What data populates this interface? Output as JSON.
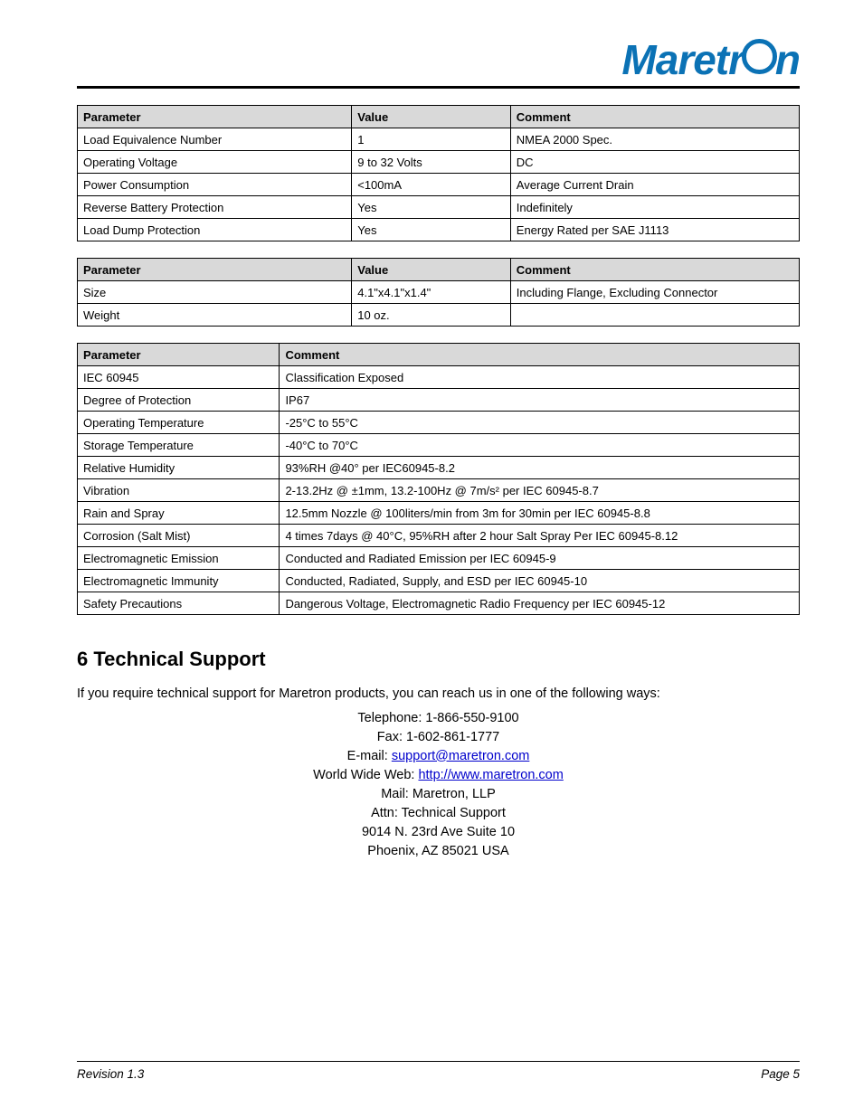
{
  "logo_text_parts": {
    "pre_o": "Maretr",
    "post_o": "n"
  },
  "table1": {
    "headers": [
      "Parameter",
      "Value",
      "Comment"
    ],
    "rows": [
      [
        "Load Equivalence Number",
        "1",
        "NMEA 2000 Spec."
      ],
      [
        "Operating Voltage",
        "9 to 32 Volts",
        "DC"
      ],
      [
        "Power Consumption",
        "<100mA",
        "Average Current Drain"
      ],
      [
        "Reverse Battery Protection",
        "Yes",
        "Indefinitely"
      ],
      [
        "Load Dump Protection",
        "Yes",
        "Energy Rated per SAE J1113"
      ]
    ]
  },
  "table2": {
    "headers": [
      "Parameter",
      "Value",
      "Comment"
    ],
    "rows": [
      [
        "Size",
        "4.1\"x4.1\"x1.4\"",
        "Including Flange, Excluding Connector"
      ],
      [
        "Weight",
        "10 oz.",
        ""
      ]
    ]
  },
  "table3": {
    "headers": [
      "Parameter",
      "Comment"
    ],
    "rows": [
      [
        "IEC 60945",
        "Classification Exposed"
      ],
      [
        "Degree of Protection",
        "IP67"
      ],
      [
        "Operating Temperature",
        "-25°C to 55°C"
      ],
      [
        "Storage Temperature",
        "-40°C to 70°C"
      ],
      [
        "Relative Humidity",
        "93%RH @40° per IEC60945-8.2"
      ],
      [
        "Vibration",
        "2-13.2Hz @ ±1mm, 13.2-100Hz @ 7m/s² per IEC 60945-8.7"
      ],
      [
        "Rain and Spray",
        "12.5mm Nozzle @ 100liters/min from 3m for 30min per IEC 60945-8.8"
      ],
      [
        "Corrosion (Salt Mist)",
        "4 times 7days @ 40°C, 95%RH after 2 hour Salt Spray Per IEC 60945-8.12"
      ],
      [
        "Electromagnetic Emission",
        "Conducted and Radiated Emission per IEC 60945-9"
      ],
      [
        "Electromagnetic Immunity",
        "Conducted, Radiated, Supply, and ESD per IEC 60945-10"
      ],
      [
        "Safety Precautions",
        "Dangerous Voltage, Electromagnetic Radio Frequency per IEC 60945-12"
      ]
    ]
  },
  "support_heading": "6 Technical Support",
  "support_intro": "If you require technical support for Maretron products, you can reach us in one of the following ways:",
  "contact": {
    "phone_label": "Telephone:",
    "phone": "1-866-550-9100",
    "fax_label": "Fax:",
    "fax": "1-602-861-1777",
    "email_label": "E-mail:",
    "email": "support@maretron.com",
    "web_label": "World Wide Web:",
    "web": "http://www.maretron.com",
    "mail_label": "Mail:",
    "mail_name": "Maretron, LLP",
    "mail_attn": "Attn: Technical Support",
    "mail_street": "9014 N. 23rd Ave Suite 10",
    "mail_city": "Phoenix, AZ 85021 USA"
  },
  "footer": {
    "left": "Revision 1.3",
    "right": "Page 5"
  }
}
